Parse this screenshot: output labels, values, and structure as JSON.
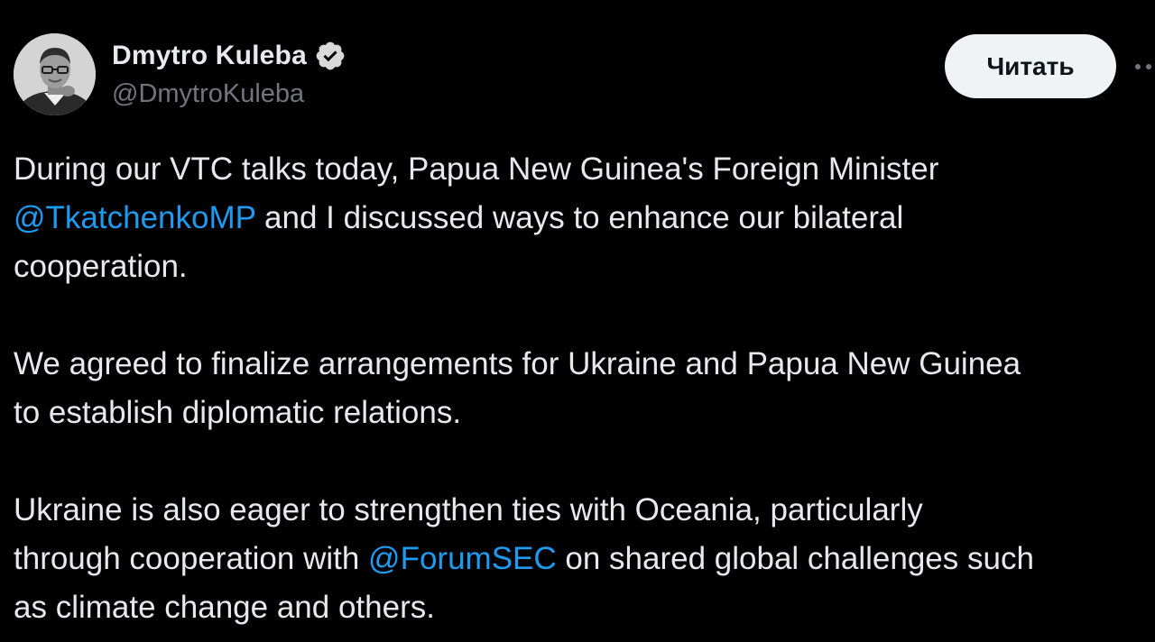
{
  "author": {
    "display_name": "Dmytro Kuleba",
    "handle": "@DmytroKuleba",
    "verified": true,
    "avatar": "profile-photo"
  },
  "follow_button": {
    "label": "Читать"
  },
  "more_button": {
    "icon": "more-horizontal-icon"
  },
  "colors": {
    "background": "#000000",
    "text": "#e7e9ea",
    "secondary_text": "#71767b",
    "link": "#1d9bf0",
    "verified_badge": "#d9d9d9",
    "button_bg": "#eff3f4"
  },
  "tweet": {
    "paragraph1": {
      "line1": "During our VTC talks today, Papua New Guinea's Foreign Minister",
      "line2_mention": "@TkatchenkoMP",
      "line2_rest": " and I discussed ways to enhance our bilateral",
      "line3": "cooperation."
    },
    "paragraph2": {
      "line1": "We agreed to finalize arrangements for Ukraine and Papua New Guinea",
      "line2": "to establish diplomatic relations."
    },
    "paragraph3": {
      "line1": "Ukraine is also eager to strengthen ties with Oceania, particularly",
      "line2_before": "through cooperation with ",
      "line2_mention": "@ForumSEC",
      "line2_after": " on shared global challenges such",
      "line3": "as climate change and others."
    }
  }
}
